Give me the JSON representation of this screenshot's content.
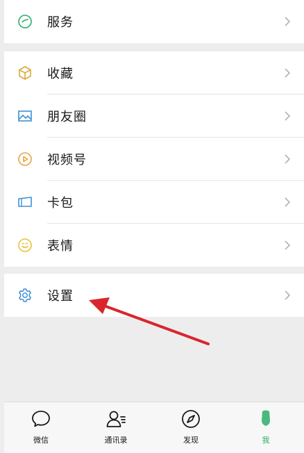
{
  "menu": {
    "services": {
      "label": "服务",
      "icon": "services-icon"
    },
    "items": [
      {
        "label": "收藏",
        "icon": "favorites-cube-icon"
      },
      {
        "label": "朋友圈",
        "icon": "moments-image-icon"
      },
      {
        "label": "视频号",
        "icon": "channels-play-icon"
      },
      {
        "label": "卡包",
        "icon": "cards-icon"
      },
      {
        "label": "表情",
        "icon": "stickers-smiley-icon"
      }
    ],
    "settings": {
      "label": "设置",
      "icon": "gear-icon"
    }
  },
  "tabbar": {
    "tabs": [
      {
        "label": "微信",
        "icon": "chat-bubble-icon"
      },
      {
        "label": "通讯录",
        "icon": "contacts-icon"
      },
      {
        "label": "发现",
        "icon": "compass-icon"
      },
      {
        "label": "我",
        "icon": "me-person-icon",
        "active": true
      }
    ]
  },
  "colors": {
    "accent_green": "#2aae67",
    "annotation_arrow": "#d9252d",
    "background": "#ededed"
  }
}
